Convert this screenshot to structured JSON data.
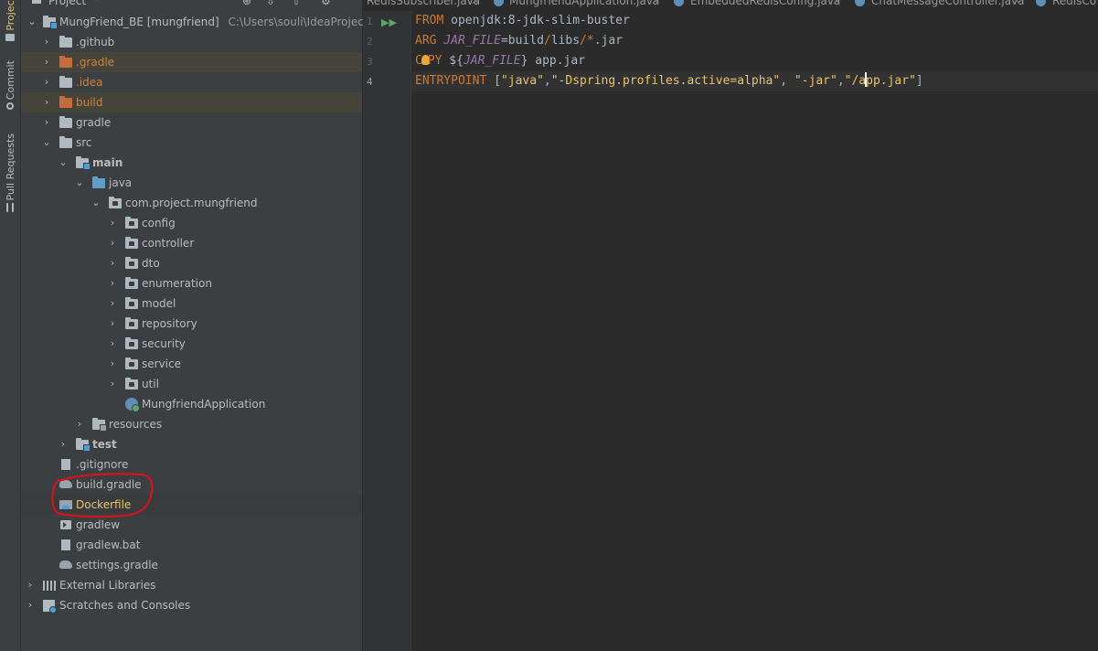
{
  "sidebar_tabs": [
    {
      "label": "Project"
    },
    {
      "label": "Commit"
    },
    {
      "label": "Pull Requests"
    }
  ],
  "project_panel": {
    "title": "Project",
    "root": {
      "name": "MungFriend_BE",
      "module": "[mungfriend]",
      "path": "C:\\Users\\souli\\IdeaProjects\\"
    },
    "items": [
      {
        "label": ".github"
      },
      {
        "label": ".gradle"
      },
      {
        "label": ".idea"
      },
      {
        "label": "build"
      },
      {
        "label": "gradle"
      },
      {
        "label": "src"
      },
      {
        "label": "main"
      },
      {
        "label": "java"
      },
      {
        "label": "com.project.mungfriend"
      },
      {
        "label": "config"
      },
      {
        "label": "controller"
      },
      {
        "label": "dto"
      },
      {
        "label": "enumeration"
      },
      {
        "label": "model"
      },
      {
        "label": "repository"
      },
      {
        "label": "security"
      },
      {
        "label": "service"
      },
      {
        "label": "util"
      },
      {
        "label": "MungfriendApplication"
      },
      {
        "label": "resources"
      },
      {
        "label": "test"
      },
      {
        "label": ".gitignore"
      },
      {
        "label": "build.gradle"
      },
      {
        "label": "Dockerfile"
      },
      {
        "label": "gradlew"
      },
      {
        "label": "gradlew.bat"
      },
      {
        "label": "settings.gradle"
      },
      {
        "label": "External Libraries"
      },
      {
        "label": "Scratches and Consoles"
      }
    ]
  },
  "editor": {
    "tabs": [
      {
        "label": "RedisSubscriber.java"
      },
      {
        "label": "MungfriendApplication.java"
      },
      {
        "label": "EmbeddedRedisConfig.java"
      },
      {
        "label": "ChatMessageController.java"
      },
      {
        "label": "RedisCo"
      }
    ],
    "line_numbers": [
      "1",
      "2",
      "3",
      "4"
    ],
    "code": {
      "l1_kw": "FROM",
      "l1_rest": " openjdk:8-jdk-slim-buster",
      "l2_kw": "ARG",
      "l2_var": "JAR_FILE",
      "l2_eq": "=build",
      "l2_s1": "/",
      "l2_libs": "libs",
      "l2_s2": "/*",
      "l2_ext": ".jar",
      "l3_kw_a": "C",
      "l3_kw_b": "PY",
      "l3_d1": " ${",
      "l3_var": "JAR_FILE",
      "l3_d2": "}",
      "l3_rest": " app.jar",
      "l4_kw": "ENTRYPOINT",
      "l4_b1": " [",
      "l4_q1": "\"java\"",
      "l4_c1": ",",
      "l4_q2": "\"-Dspring.profiles.active=alpha\"",
      "l4_c2": ", ",
      "l4_q3": "\"-jar\"",
      "l4_c3": ",",
      "l4_q4a": "\"/a",
      "l4_q4b": "pp.jar\"",
      "l4_b2": "]"
    }
  },
  "colors": {
    "keyword": "#cc7832",
    "variable": "#9876aa",
    "string": "#6a8759",
    "annotation_circle": "#e0101a"
  },
  "icons": [
    "folder-icon",
    "gradle-icon",
    "docker-icon",
    "run-gutter-icon",
    "intention-bulb-icon"
  ]
}
